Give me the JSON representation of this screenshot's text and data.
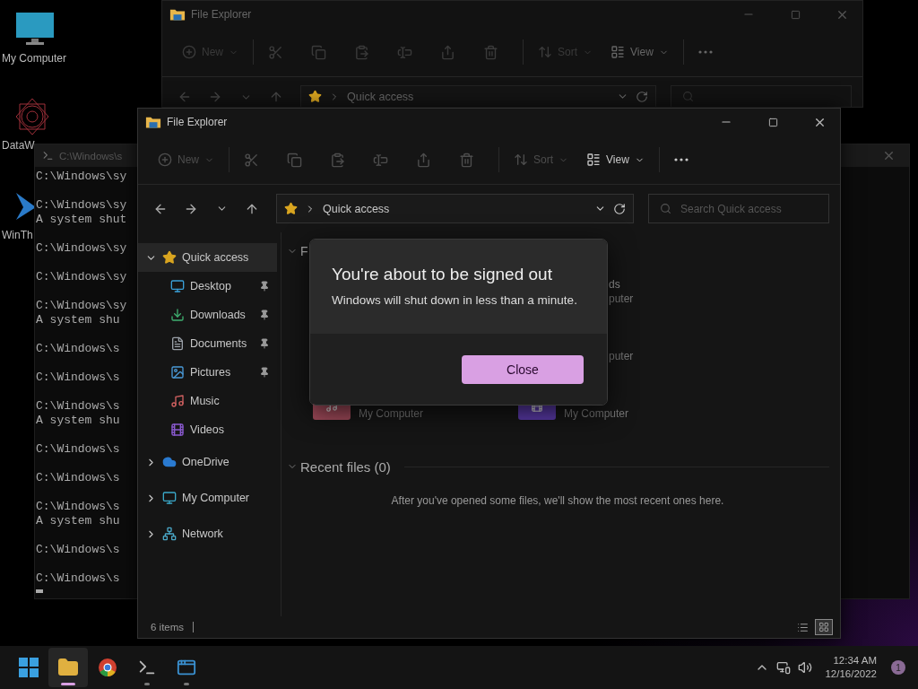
{
  "desktop_icons": [
    {
      "kind": "computer",
      "label": "My Computer"
    },
    {
      "kind": "spiral",
      "label": "DataW"
    },
    {
      "kind": "arrow",
      "label": "WinTh"
    }
  ],
  "back_window": {
    "title": "File Explorer",
    "toolbar": [
      {
        "kind": "new",
        "label": "New",
        "disabled": true
      },
      {
        "kind": "cut",
        "disabled": true
      },
      {
        "kind": "copy",
        "disabled": true
      },
      {
        "kind": "paste",
        "disabled": true
      },
      {
        "kind": "rename",
        "disabled": true
      },
      {
        "kind": "share",
        "disabled": true
      },
      {
        "kind": "delete",
        "disabled": true
      },
      {
        "kind": "sort",
        "label": "Sort",
        "disabled": true
      },
      {
        "kind": "view",
        "label": "View",
        "disabled": false
      },
      {
        "kind": "more",
        "disabled": false
      }
    ],
    "address": "Quick access"
  },
  "console": {
    "title": "C:\\Windows\\s",
    "blocks": [
      [
        "C:\\Windows\\sy"
      ],
      [
        "C:\\Windows\\sy",
        "A system shut"
      ],
      [
        "C:\\Windows\\sy"
      ],
      [
        "C:\\Windows\\sy"
      ],
      [
        "C:\\Windows\\sy",
        "A system shu"
      ],
      [
        "C:\\Windows\\s"
      ],
      [
        "C:\\Windows\\s"
      ],
      [
        "C:\\Windows\\s",
        "A system shu"
      ],
      [
        "C:\\Windows\\s"
      ],
      [
        "C:\\Windows\\s"
      ],
      [
        "C:\\Windows\\s",
        "A system shu"
      ],
      [
        "C:\\Windows\\s"
      ],
      [
        "C:\\Windows\\s"
      ]
    ]
  },
  "explorer": {
    "title": "File Explorer",
    "toolbar": [
      {
        "kind": "new",
        "label": "New",
        "disabled": true
      },
      {
        "kind": "cut",
        "disabled": true
      },
      {
        "kind": "copy",
        "disabled": true
      },
      {
        "kind": "paste",
        "disabled": true
      },
      {
        "kind": "rename",
        "disabled": true
      },
      {
        "kind": "share",
        "disabled": true
      },
      {
        "kind": "delete",
        "disabled": true
      },
      {
        "kind": "sort",
        "label": "Sort",
        "disabled": true
      },
      {
        "kind": "view",
        "label": "View",
        "disabled": false
      },
      {
        "kind": "more",
        "disabled": false
      }
    ],
    "address": "Quick access",
    "search": {
      "placeholder": "Search Quick access"
    },
    "nav": [
      {
        "kind": "star",
        "label": "Quick access",
        "expanded": true,
        "selected": true,
        "children": [
          {
            "kind": "desktop",
            "label": "Desktop",
            "pinned": true,
            "selected": false
          },
          {
            "kind": "downloads",
            "label": "Downloads",
            "pinned": true,
            "selected": false
          },
          {
            "kind": "documents",
            "label": "Documents",
            "pinned": true,
            "selected": false
          },
          {
            "kind": "pictures",
            "label": "Pictures",
            "pinned": true,
            "selected": false
          },
          {
            "kind": "music",
            "label": "Music",
            "pinned": false,
            "selected": false
          },
          {
            "kind": "videos",
            "label": "Videos",
            "pinned": false,
            "selected": false
          }
        ]
      },
      {
        "kind": "cloud",
        "label": "OneDrive",
        "expanded": false,
        "selected": false
      },
      {
        "kind": "computer",
        "label": "My Computer",
        "expanded": false,
        "selected": false
      },
      {
        "kind": "network",
        "label": "Network",
        "expanded": false,
        "selected": false
      }
    ],
    "folders_header": "F",
    "folders": [
      {
        "name": "ds",
        "location": "puter"
      },
      {
        "location": "puter"
      },
      {
        "kind": "music",
        "location": "My Computer"
      },
      {
        "kind": "videos",
        "location": "My Computer"
      }
    ],
    "recent_header": "Recent files (0)",
    "recent_empty": "After you've opened some files, we'll show the most recent ones here.",
    "status": "6 items",
    "view_modes": [
      {
        "kind": "details",
        "selected": false
      },
      {
        "kind": "tiles",
        "selected": true
      }
    ]
  },
  "dialog": {
    "title": "You're about to be signed out",
    "message": "Windows will shut down in less than a minute.",
    "button": "Close"
  },
  "taskbar": {
    "apps": [
      {
        "kind": "start",
        "open": false,
        "active": false
      },
      {
        "kind": "explorer",
        "open": true,
        "active": true
      },
      {
        "kind": "chrome",
        "open": false,
        "active": false
      },
      {
        "kind": "terminal",
        "open": true,
        "active": false
      },
      {
        "kind": "window",
        "open": true,
        "active": false
      }
    ],
    "time": "12:34 AM",
    "date": "12/16/2022",
    "notifications": "1"
  }
}
